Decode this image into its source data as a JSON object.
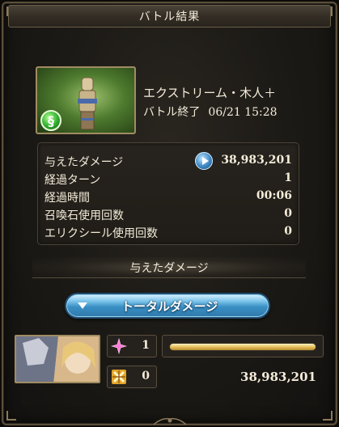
{
  "window": {
    "title": "バトル結果"
  },
  "quest": {
    "name": "エクストリーム・木人＋",
    "end_label": "バトル終了",
    "end_datetime": "06/21 15:28",
    "element_icon": "wind-element-icon",
    "element_color": "#36b534"
  },
  "stats": [
    {
      "label": "与えたダメージ",
      "value": "38,983,201"
    },
    {
      "label": "経過ターン",
      "value": "1"
    },
    {
      "label": "経過時間",
      "value": "00:06"
    },
    {
      "label": "召喚石使用回数",
      "value": "0"
    },
    {
      "label": "エリクシール使用回数",
      "value": "0"
    }
  ],
  "damage_section": {
    "title": "与えたダメージ",
    "toggle_label": "トータルダメージ",
    "toggle_icon": "dropdown-triangle-icon",
    "accent_color": "#3a8fc4"
  },
  "characters": [
    {
      "portrait_icon": "character-portrait",
      "ability_count_icon": "sparkle-icon",
      "ability_count": "1",
      "critical_count_icon": "cross-burst-icon",
      "critical_count": "0",
      "damage_share": 1.0,
      "damage": "38,983,201"
    }
  ]
}
